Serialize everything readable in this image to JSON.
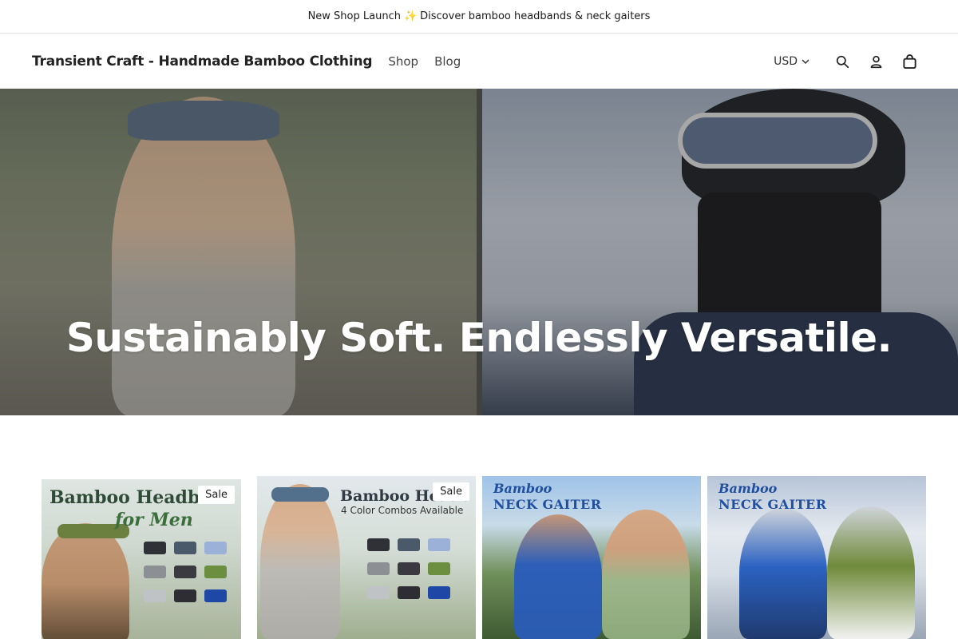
{
  "announcement": {
    "text_before": "New Shop Launch",
    "sparkle": "✨",
    "text_after": "Discover bamboo headbands & neck gaiters"
  },
  "header": {
    "brand": "Transient Craft - Handmade Bamboo Clothing",
    "nav": [
      {
        "label": "Shop"
      },
      {
        "label": "Blog"
      }
    ],
    "currency": "USD",
    "icons": [
      "search-icon",
      "account-icon",
      "cart-icon"
    ]
  },
  "hero": {
    "title": "Sustainably Soft. Endlessly Versatile."
  },
  "products": [
    {
      "headline": "Bamboo Headbar",
      "subline": "for Men",
      "badge": "Sale"
    },
    {
      "headline": "Bamboo Headb",
      "small_sub": "4 Color Combos Available",
      "badge": "Sale"
    },
    {
      "headline_top": "Bamboo",
      "headline_main": "NECK GAITER"
    },
    {
      "headline_top": "Bamboo",
      "headline_main": "NECK GAITER"
    }
  ],
  "colors": {
    "accent_sparkle": "#f2b200",
    "headline_green": "#2f4a36",
    "gaiter_blue": "#1f4fa0"
  }
}
